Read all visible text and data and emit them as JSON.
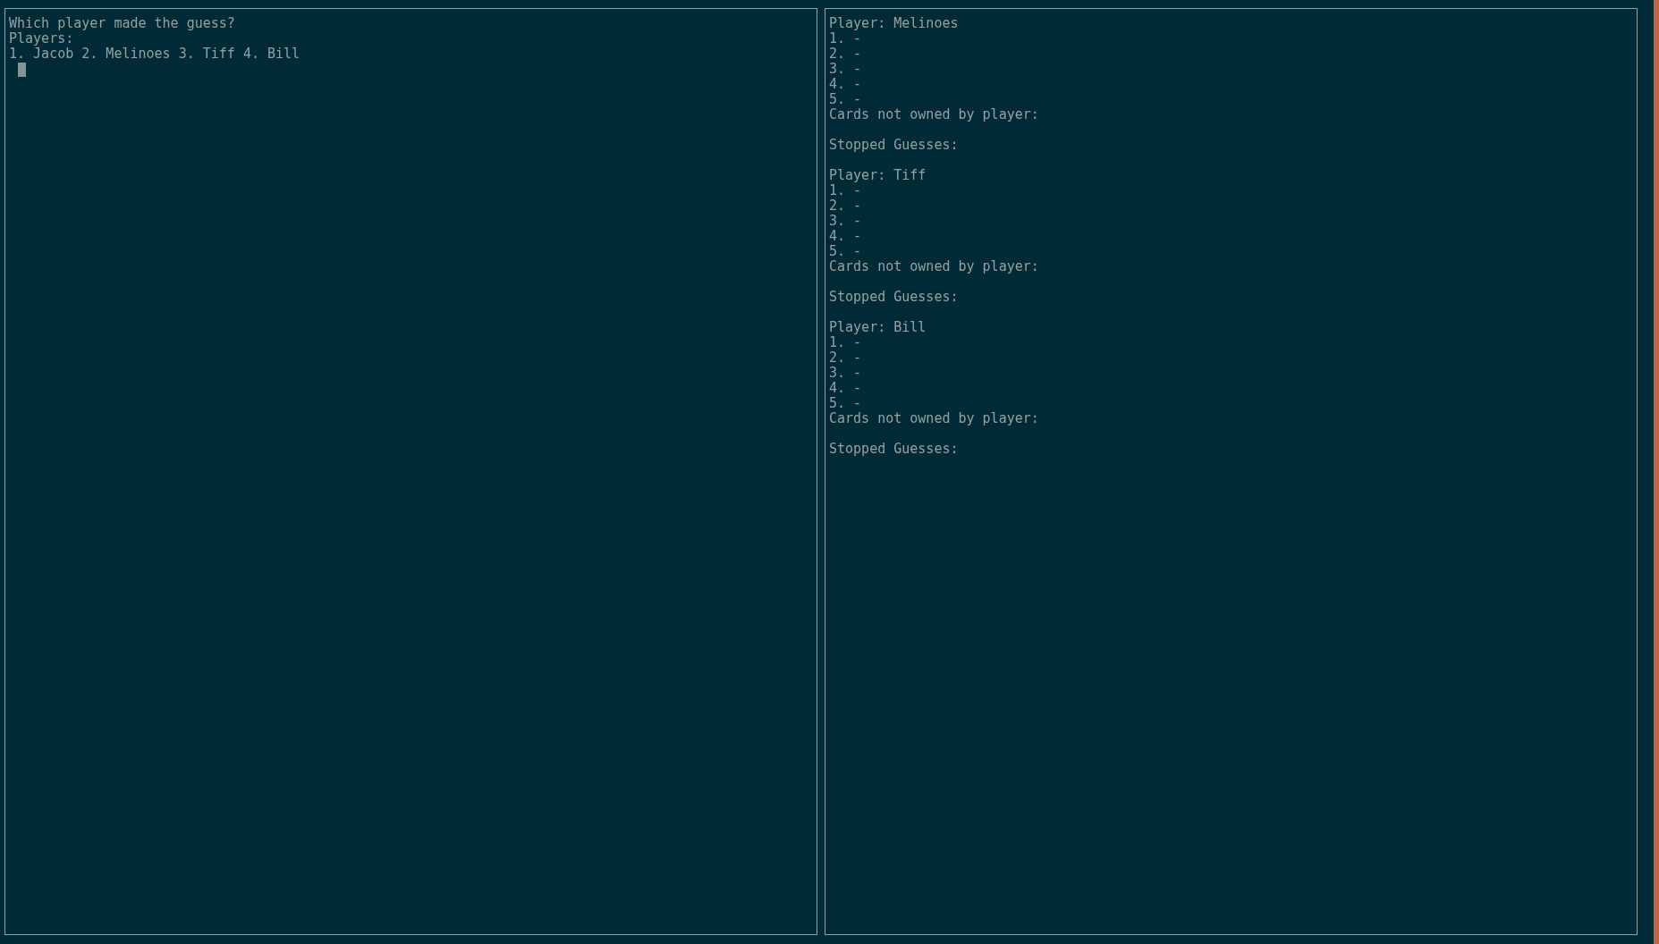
{
  "left_pane": {
    "lines": [
      "Which player made the guess?",
      "Players:",
      "1. Jacob 2. Melinoes 3. Tiff 4. Bill"
    ]
  },
  "right_pane": {
    "players": [
      {
        "header": "Player: Melinoes",
        "cards": [
          "1. -",
          "2. -",
          "3. -",
          "4. -",
          "5. -"
        ],
        "not_owned_label": "Cards not owned by player:",
        "stopped_label": "Stopped Guesses:"
      },
      {
        "header": "Player: Tiff",
        "cards": [
          "1. -",
          "2. -",
          "3. -",
          "4. -",
          "5. -"
        ],
        "not_owned_label": "Cards not owned by player:",
        "stopped_label": "Stopped Guesses:"
      },
      {
        "header": "Player: Bill",
        "cards": [
          "1. -",
          "2. -",
          "3. -",
          "4. -",
          "5. -"
        ],
        "not_owned_label": "Cards not owned by player:",
        "stopped_label": "Stopped Guesses:"
      }
    ]
  }
}
